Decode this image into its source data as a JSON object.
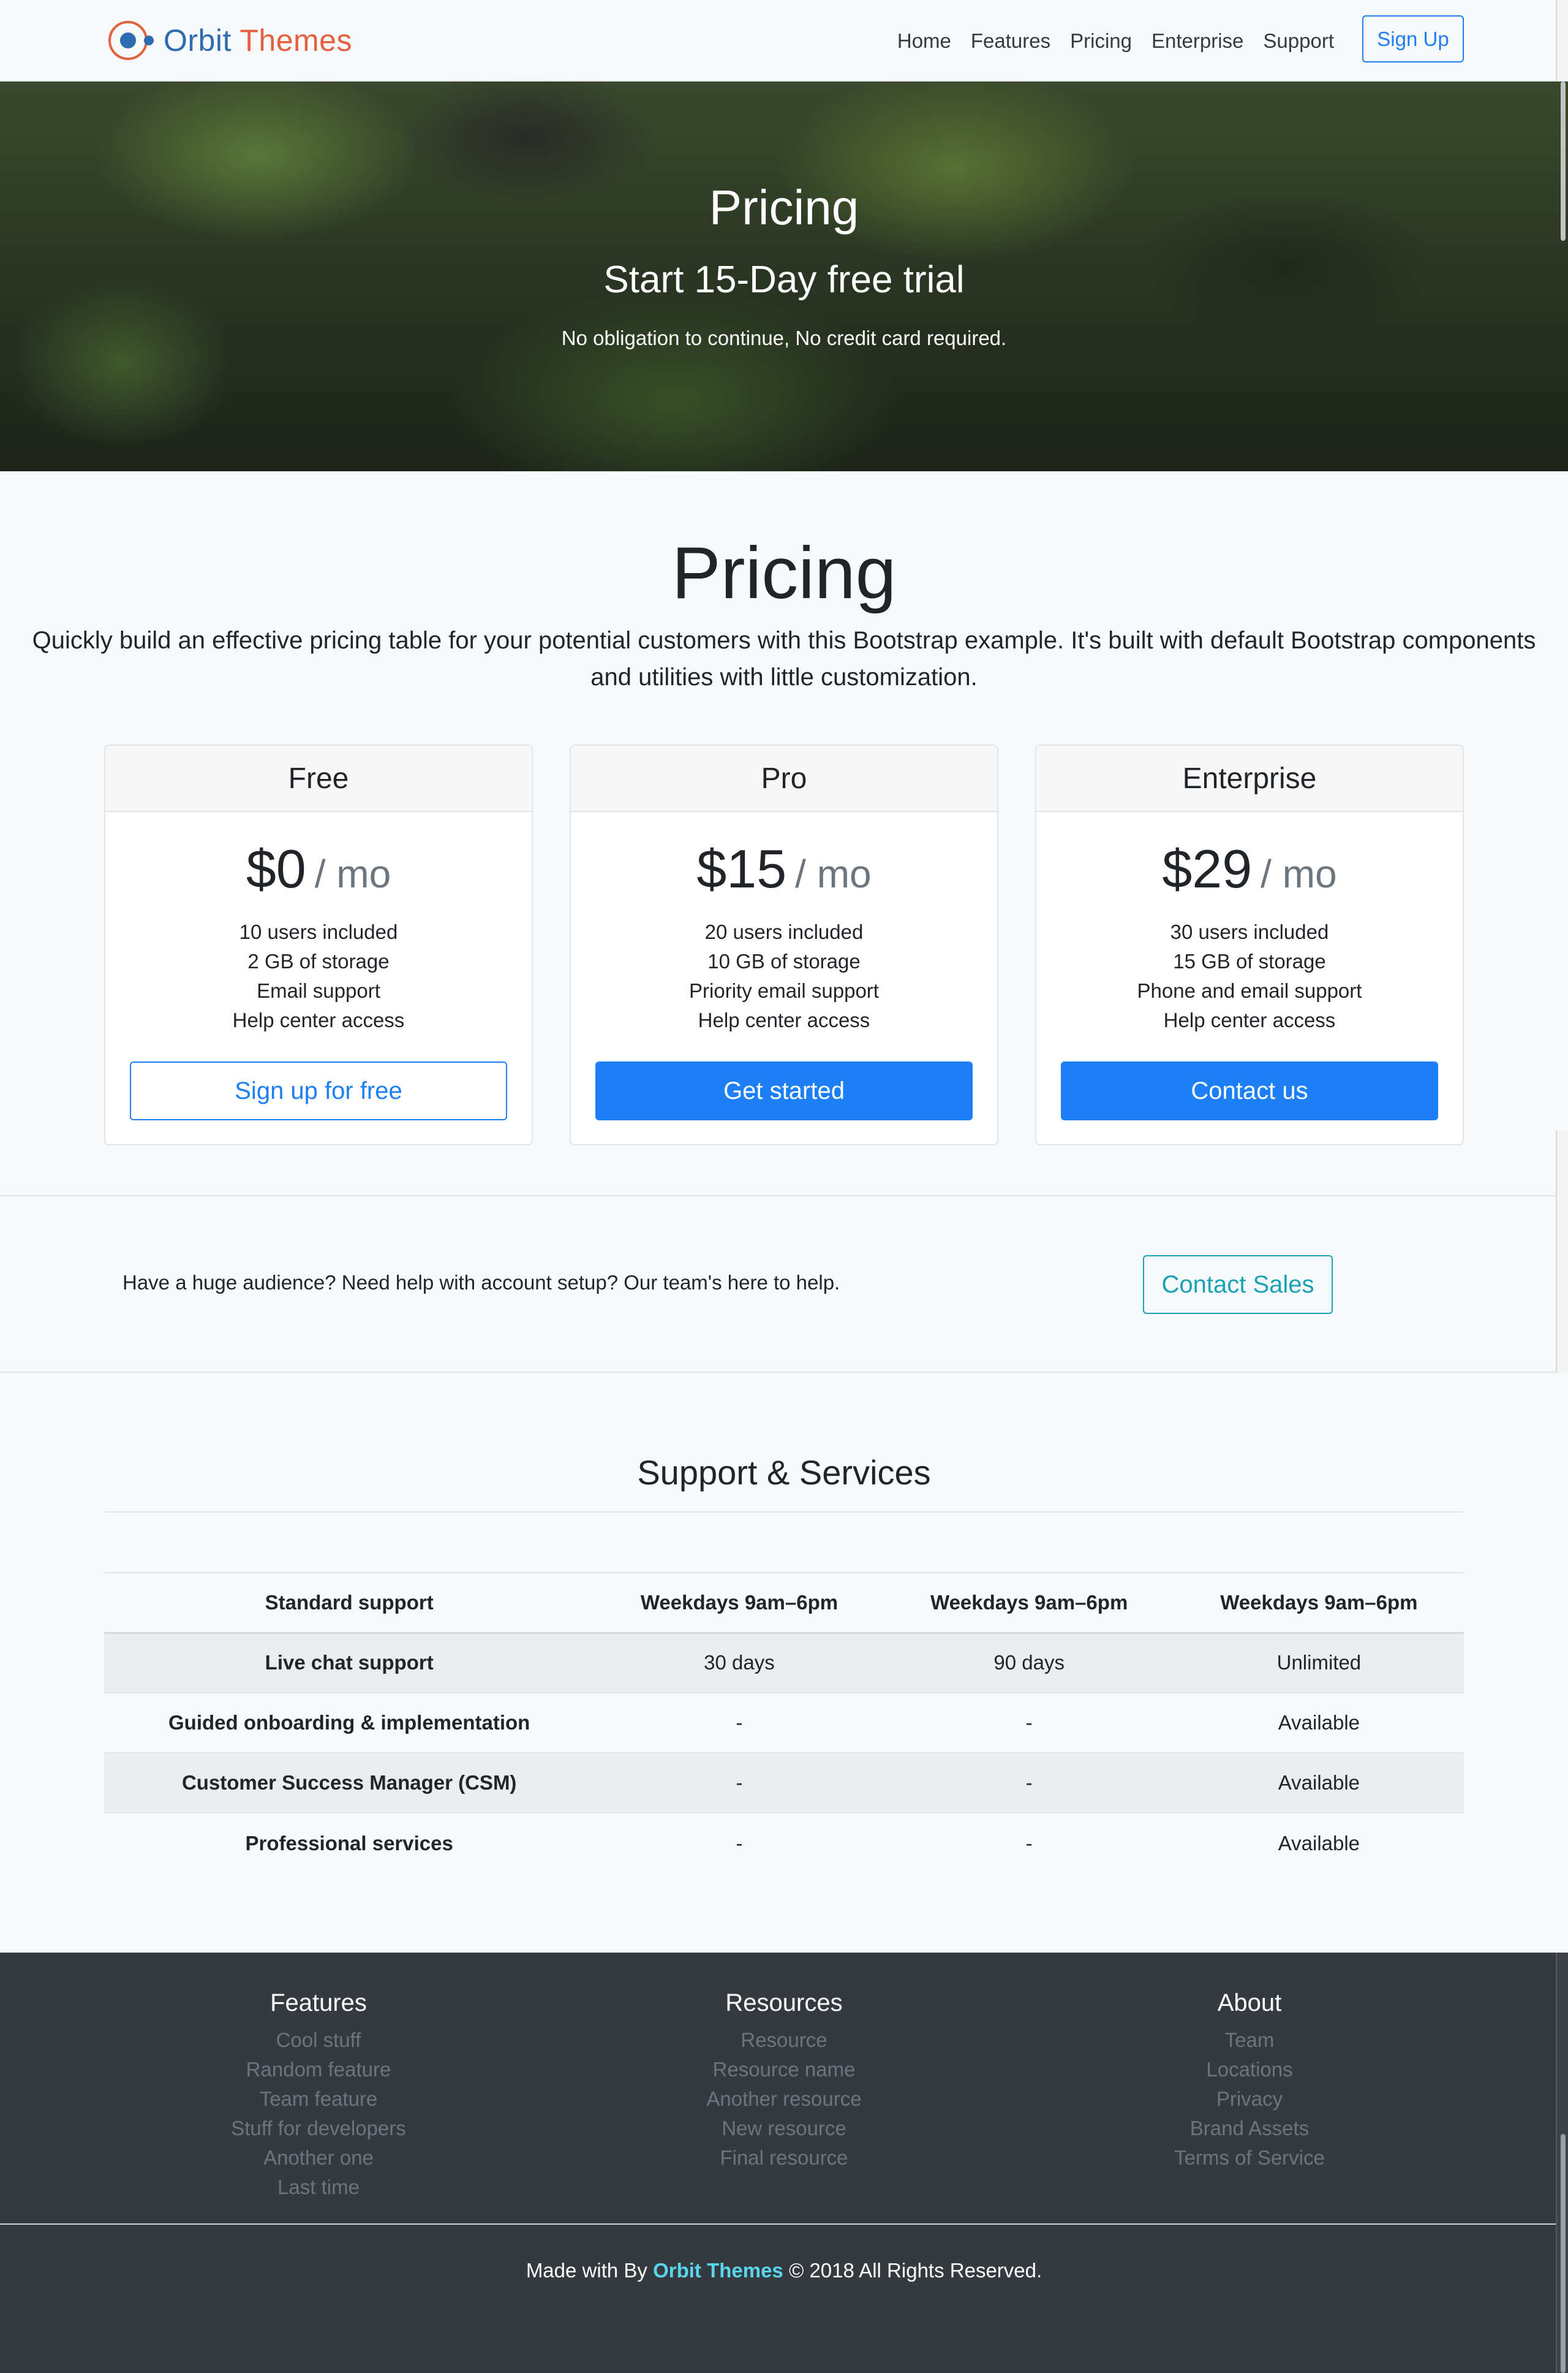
{
  "nav": {
    "brand": {
      "word1": "Orbit",
      "word2": "Themes"
    },
    "links": [
      "Home",
      "Features",
      "Pricing",
      "Enterprise",
      "Support"
    ],
    "signup": "Sign Up"
  },
  "hero": {
    "title": "Pricing",
    "subtitle": "Start 15-Day free trial",
    "note": "No obligation to continue, No credit card required."
  },
  "pricing": {
    "title": "Pricing",
    "lead": "Quickly build an effective pricing table for your potential customers with this Bootstrap example. It's built with default Bootstrap components and utilities with little customization.",
    "plans": [
      {
        "name": "Free",
        "price": "$0",
        "period": "/ mo",
        "features": [
          "10 users included",
          "2 GB of storage",
          "Email support",
          "Help center access"
        ],
        "button": "Sign up for free"
      },
      {
        "name": "Pro",
        "price": "$15",
        "period": "/ mo",
        "features": [
          "20 users included",
          "10 GB of storage",
          "Priority email support",
          "Help center access"
        ],
        "button": "Get started"
      },
      {
        "name": "Enterprise",
        "price": "$29",
        "period": "/ mo",
        "features": [
          "30 users included",
          "15 GB of storage",
          "Phone and email support",
          "Help center access"
        ],
        "button": "Contact us"
      }
    ]
  },
  "cta": {
    "text": "Have a huge audience? Need help with account setup? Our team's here to help.",
    "button": "Contact Sales"
  },
  "support": {
    "title": "Support & Services",
    "rows": [
      [
        "Standard support",
        "Weekdays 9am–6pm",
        "Weekdays 9am–6pm",
        "Weekdays 9am–6pm"
      ],
      [
        "Live chat support",
        "30 days",
        "90 days",
        "Unlimited"
      ],
      [
        "Guided onboarding & implementation",
        "-",
        "-",
        "Available"
      ],
      [
        "Customer Success Manager (CSM)",
        "-",
        "-",
        "Available"
      ],
      [
        "Professional services",
        "-",
        "-",
        "Available"
      ]
    ]
  },
  "footer": {
    "columns": [
      {
        "heading": "Features",
        "links": [
          "Cool stuff",
          "Random feature",
          "Team feature",
          "Stuff for developers",
          "Another one",
          "Last time"
        ]
      },
      {
        "heading": "Resources",
        "links": [
          "Resource",
          "Resource name",
          "Another resource",
          "New resource",
          "Final resource"
        ]
      },
      {
        "heading": "About",
        "links": [
          "Team",
          "Locations",
          "Privacy",
          "Brand Assets",
          "Terms of Service"
        ]
      }
    ],
    "copy_prefix": "Made with By",
    "copy_brand": "Orbit Themes",
    "copy_suffix": "© 2018 All Rights Reserved."
  },
  "colors": {
    "primary": "#1d7ff5",
    "info": "#17a2b8",
    "footer_bg": "#343a40",
    "brand_blue": "#2b6cb0",
    "brand_orange": "#e4603f"
  }
}
